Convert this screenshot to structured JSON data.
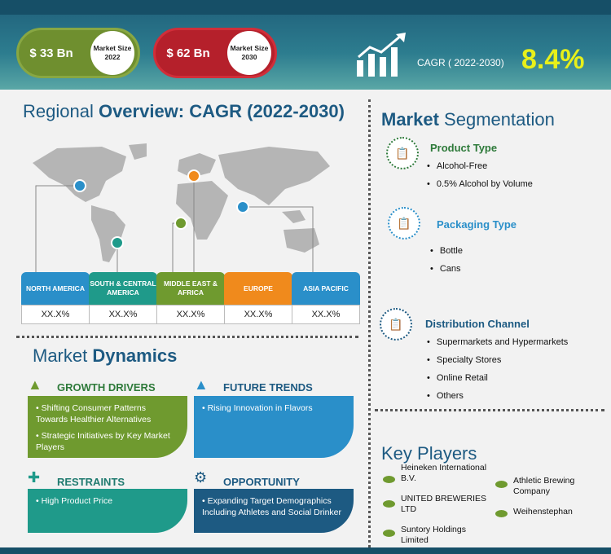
{
  "header": {
    "market_2022_value": "$ 33 Bn",
    "market_2022_label": "Market Size 2022",
    "market_2030_value": "$ 62 Bn",
    "market_2030_label": "Market Size 2030",
    "cagr_label": "CAGR ( 2022-2030)",
    "cagr_value": "8.4%"
  },
  "regional": {
    "title_a": "Regional ",
    "title_b": "Overview: CAGR (2022-2030)",
    "regions": [
      {
        "name": "NORTH AMERICA",
        "value": "XX.X%",
        "color": "#2a8fc9"
      },
      {
        "name": "SOUTH & CENTRAL AMERICA",
        "value": "XX.X%",
        "color": "#1f9a8a"
      },
      {
        "name": "MIDDLE EAST & AFRICA",
        "value": "XX.X%",
        "color": "#6f9a2f"
      },
      {
        "name": "EUROPE",
        "value": "XX.X%",
        "color": "#f08a1c"
      },
      {
        "name": "ASIA PACIFIC",
        "value": "XX.X%",
        "color": "#2a8fc9"
      }
    ]
  },
  "segmentation": {
    "title_a": "Market ",
    "title_b": "Segmentation",
    "product_type": {
      "title": "Product Type",
      "items": [
        "Alcohol-Free",
        "0.5% Alcohol by Volume"
      ]
    },
    "packaging_type": {
      "title": "Packaging Type",
      "items": [
        "Bottle",
        "Cans"
      ]
    },
    "distribution": {
      "title": "Distribution Channel",
      "items": [
        "Supermarkets and Hypermarkets",
        "Specialty  Stores",
        "Online Retail",
        "Others"
      ]
    }
  },
  "dynamics": {
    "title_a": "Market ",
    "title_b": "Dynamics",
    "growth_drivers": {
      "title": "GROWTH DRIVERS",
      "items": [
        "Shifting Consumer Patterns Towards Healthier Alternatives",
        "Strategic Initiatives by Key Market Players"
      ],
      "color": "#6f9a2f"
    },
    "future_trends": {
      "title": "FUTURE TRENDS",
      "items": [
        "Rising Innovation in Flavors"
      ],
      "color": "#2a8fc9"
    },
    "restraints": {
      "title": "RESTRAINTS",
      "items": [
        "High Product Price"
      ],
      "color": "#1f9a8a"
    },
    "opportunity": {
      "title": "OPPORTUNITY",
      "items": [
        "Expanding Target Demographics Including Athletes and Social Drinker"
      ],
      "color": "#1d5a82"
    }
  },
  "key_players": {
    "title": "Key Players",
    "left": [
      "Heineken International B.V.",
      "UNITED BREWERIES LTD",
      "Suntory Holdings Limited"
    ],
    "right": [
      "Athletic Brewing Company",
      "Weihenstephan"
    ]
  }
}
